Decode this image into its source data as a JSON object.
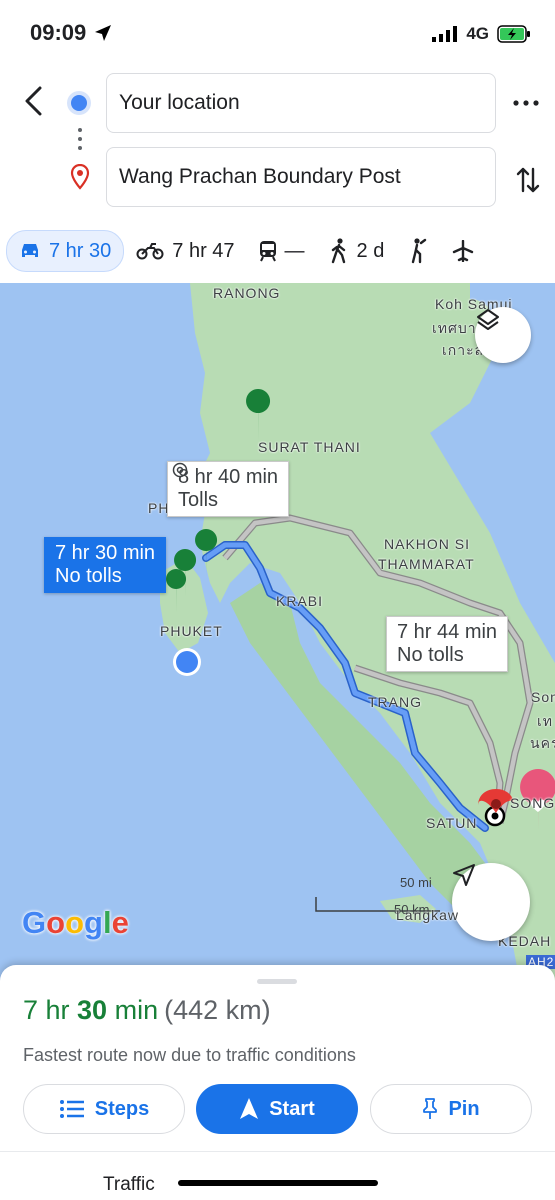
{
  "status": {
    "time": "09:09",
    "network": "4G"
  },
  "directions": {
    "origin": "Your location",
    "destination": "Wang Prachan Boundary Post"
  },
  "modes": [
    {
      "icon": "car-icon",
      "label": "7 hr 30",
      "selected": true
    },
    {
      "icon": "motorcycle-icon",
      "label": "7 hr 47"
    },
    {
      "icon": "transit-icon",
      "label": "—"
    },
    {
      "icon": "walk-icon",
      "label": "2 d"
    },
    {
      "icon": "ride-icon",
      "label": ""
    },
    {
      "icon": "flight-icon",
      "label": ""
    }
  ],
  "map": {
    "labels": {
      "ranong": "RANONG",
      "koh_samui": "Koh Samui",
      "koh_samui_th1": "เทศบา",
      "koh_samui_th2": "เกาะส",
      "surat_thani": "SURAT THANI",
      "ph": "PH",
      "nakhon1": "NAKHON SI",
      "nakhon2": "THAMMARAT",
      "krabi": "KRABI",
      "phuket": "PHUKET",
      "trang": "TRANG",
      "satun": "SATUN",
      "song": "SONG",
      "son": "Son",
      "th_right1": "เท",
      "th_right2": "นคร",
      "kedah": "KEDAH",
      "ah2": "AH2",
      "langkawi": "Langkaw"
    },
    "routes": [
      {
        "duration": "7 hr 30 min",
        "note": "No tolls",
        "selected": true
      },
      {
        "duration": "8 hr 40 min",
        "note": "Tolls",
        "selected": false
      },
      {
        "duration": "7 hr 44 min",
        "note": "No tolls",
        "selected": false
      }
    ],
    "scale": {
      "top": "50 mi",
      "bottom": "50 km"
    },
    "logo": "Google"
  },
  "sheet": {
    "duration_value": "7 hr ",
    "duration_num": "30",
    "duration_unit": " min",
    "distance": "(442 km)",
    "reason": "Fastest route now due to traffic conditions",
    "steps": "Steps",
    "start": "Start",
    "pin": "Pin",
    "traffic": "Traffic"
  },
  "colors": {
    "accent": "#1a73e8",
    "eta_green": "#188038",
    "route_blue": "#4a8fe8",
    "alt_route": "#a8a8a8",
    "land": "#b8dcb4",
    "water": "#9ec3f2"
  }
}
